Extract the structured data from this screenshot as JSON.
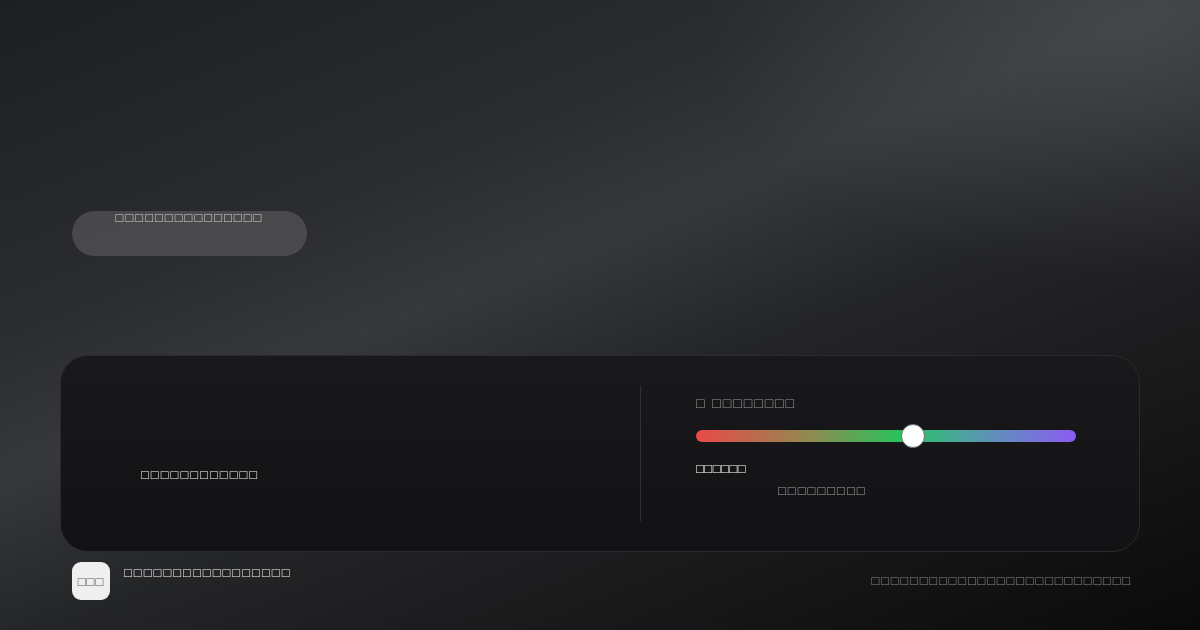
{
  "pill": {
    "label": "□□□□□□□□□□□□□□□"
  },
  "panel": {
    "message": "□□□□□□□□□□□□",
    "slider": {
      "label": "□ □□□□□□□□",
      "level": 0.57,
      "value": "□□□□□□",
      "caption": "□□□□□□□□□"
    }
  },
  "footer": {
    "logo": "□□□",
    "title": "□□□□□□□□□□□□□□□□□",
    "note": "□□□□□□□□□□□□□□□□□□□□□□□□□□□"
  }
}
